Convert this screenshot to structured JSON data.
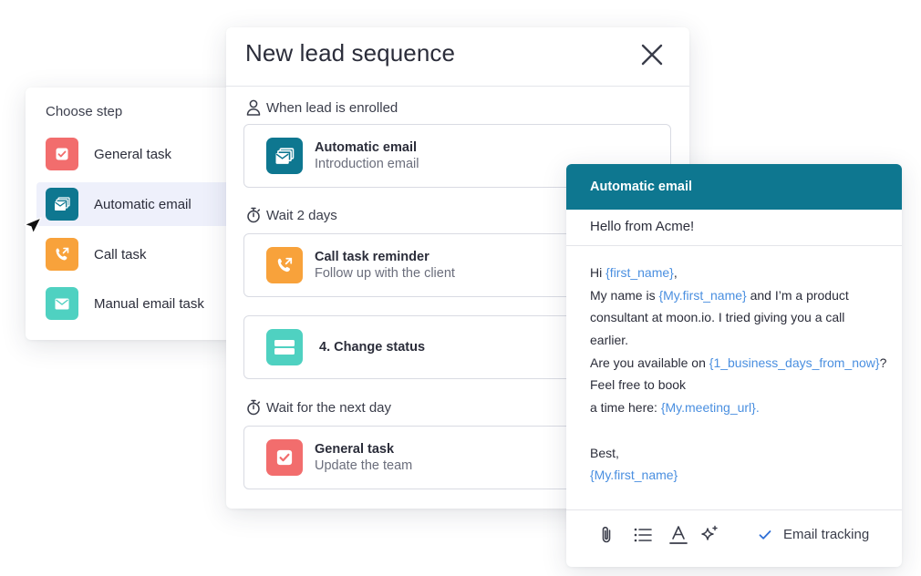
{
  "chooser": {
    "title": "Choose step",
    "items": [
      {
        "label": "General task",
        "icon": "checkbox-icon",
        "color": "#f26d6d"
      },
      {
        "label": "Automatic email",
        "icon": "email-stack-icon",
        "color": "#0e7790"
      },
      {
        "label": "Call task",
        "icon": "phone-call-icon",
        "color": "#f8a23b"
      },
      {
        "label": "Manual email task",
        "icon": "envelope-icon",
        "color": "#4fd1c1"
      }
    ]
  },
  "sequence": {
    "title": "New lead sequence",
    "sections": [
      {
        "label": "When lead is enrolled",
        "icon": "person-icon"
      },
      {
        "label": "Wait 2 days",
        "icon": "stopwatch-icon"
      },
      {
        "label": "Wait for the next day",
        "icon": "stopwatch-icon"
      }
    ],
    "steps": [
      {
        "title": "Automatic email",
        "subtitle": "Introduction email",
        "icon": "email-stack-icon",
        "color": "#0e7790"
      },
      {
        "title": "Call task reminder",
        "subtitle": "Follow up with the client",
        "icon": "phone-call-icon",
        "color": "#f8a23b"
      },
      {
        "title": "4. Change status",
        "subtitle": "",
        "icon": "status-icon",
        "color": "#4fd1c1"
      },
      {
        "title": "General task",
        "subtitle": "Update the team",
        "icon": "checkbox-icon",
        "color": "#f26d6d"
      }
    ]
  },
  "email": {
    "header": "Automatic email",
    "subject": "Hello from Acme!",
    "body": {
      "l1_a": "Hi ",
      "l1_var": "{first_name}",
      "l1_b": ",",
      "l2_a": "My name is ",
      "l2_var": "{My.first_name}",
      "l2_b": " and I’m a product",
      "l3": "consultant at moon.io. I tried giving you a call",
      "l4": "earlier.",
      "l5_a": "Are you available on ",
      "l5_var": "{1_business_days_from_now}",
      "l5_b": "?",
      "l6": "Feel free to book",
      "l7_a": "a time here: ",
      "l7_var": "{My.meeting_url}.",
      "l8": "Best,",
      "l9_var": "{My.first_name}"
    },
    "toolbar": {
      "icons": [
        "paperclip-icon",
        "list-icon",
        "text-format-icon",
        "sparkle-icon"
      ],
      "tracking_label": "Email tracking",
      "tracking_checked": true
    },
    "accent_color": "#0e7790",
    "variable_color": "#4a8fe0"
  }
}
